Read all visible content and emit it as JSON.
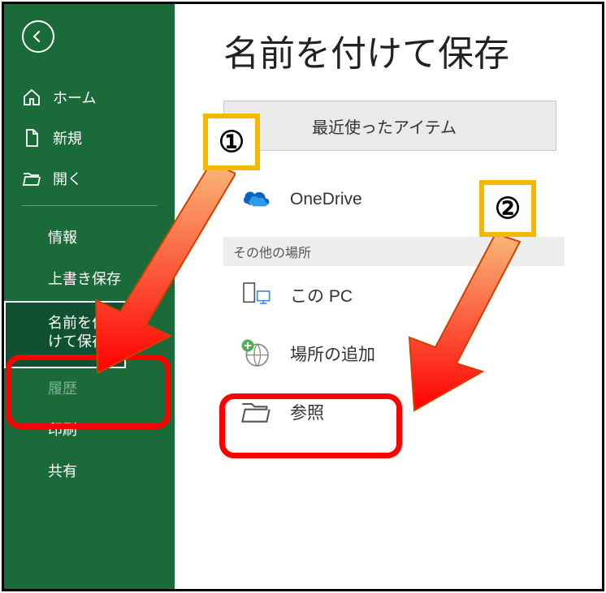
{
  "sidebar": {
    "home": "ホーム",
    "new": "新規",
    "open": "開く",
    "info": "情報",
    "save": "上書き保存",
    "saveas": "名前を付けて保存",
    "history": "履歴",
    "print": "印刷",
    "share": "共有"
  },
  "page": {
    "title": "名前を付けて保存",
    "recent": "最近使ったアイテム",
    "onedrive": "OneDrive",
    "other_locations": "その他の場所",
    "this_pc": "この PC",
    "add_location": "場所の追加",
    "browse": "参照"
  },
  "annotations": {
    "step1": "①",
    "step2": "②"
  }
}
